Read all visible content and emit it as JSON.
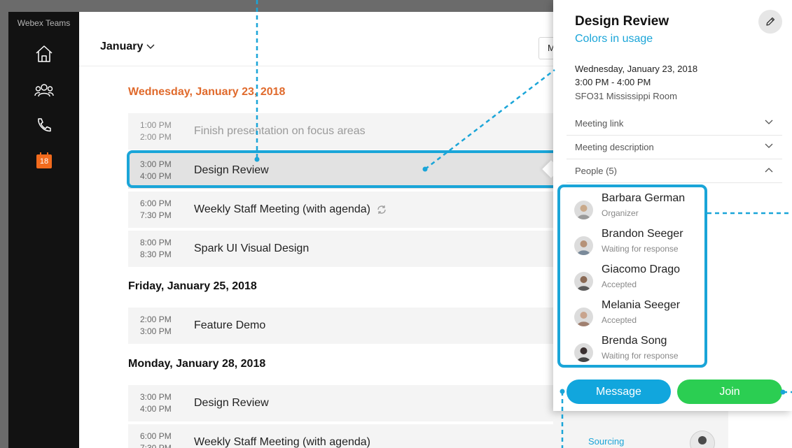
{
  "sidebar": {
    "title": "Webex Teams",
    "nav": [
      {
        "name": "home-icon"
      },
      {
        "name": "teams-icon"
      },
      {
        "name": "phone-icon"
      },
      {
        "name": "calendar-icon",
        "badge": "18"
      }
    ]
  },
  "header": {
    "month": "January",
    "view_button": "M"
  },
  "days": [
    {
      "heading": "Wednesday, January 23, 2018",
      "events": [
        {
          "start": "1:00 PM",
          "end": "2:00 PM",
          "title": "Finish presentation on focus areas"
        },
        {
          "start": "3:00 PM",
          "end": "4:00 PM",
          "title": "Design Review"
        },
        {
          "start": "6:00 PM",
          "end": "7:30 PM",
          "title": "Weekly Staff Meeting (with agenda)"
        },
        {
          "start": "8:00 PM",
          "end": "8:30 PM",
          "title": "Spark UI Visual Design"
        }
      ]
    },
    {
      "heading": "Friday, January 25, 2018",
      "events": [
        {
          "start": "2:00 PM",
          "end": "3:00 PM",
          "title": "Feature Demo"
        }
      ]
    },
    {
      "heading": "Monday, January 28, 2018",
      "events": [
        {
          "start": "3:00 PM",
          "end": "4:00 PM",
          "title": "Design Review"
        },
        {
          "start": "6:00 PM",
          "end": "7:30 PM",
          "title": "Weekly Staff Meeting (with agenda)"
        }
      ]
    }
  ],
  "row_extra": {
    "sourcing": "Sourcing"
  },
  "detail": {
    "title": "Design Review",
    "subtitle": "Colors in usage",
    "date": "Wednesday, January 23, 2018",
    "time": "3:00 PM - 4:00 PM",
    "location": "SFO31 Mississippi Room",
    "sections": {
      "link": "Meeting link",
      "description": "Meeting description",
      "people": "People (5)"
    },
    "people": [
      {
        "name": "Barbara German",
        "status": "Organizer"
      },
      {
        "name": "Brandon Seeger",
        "status": "Waiting for response"
      },
      {
        "name": "Giacomo Drago",
        "status": "Accepted"
      },
      {
        "name": "Melania Seeger",
        "status": "Accepted"
      },
      {
        "name": "Brenda Song",
        "status": "Waiting for response"
      }
    ],
    "buttons": {
      "message": "Message",
      "join": "Join"
    }
  },
  "colors": {
    "accent": "#1aa5d8",
    "join": "#2bce52",
    "today": "#e06a2c",
    "calendar_badge": "#f26b1d"
  }
}
